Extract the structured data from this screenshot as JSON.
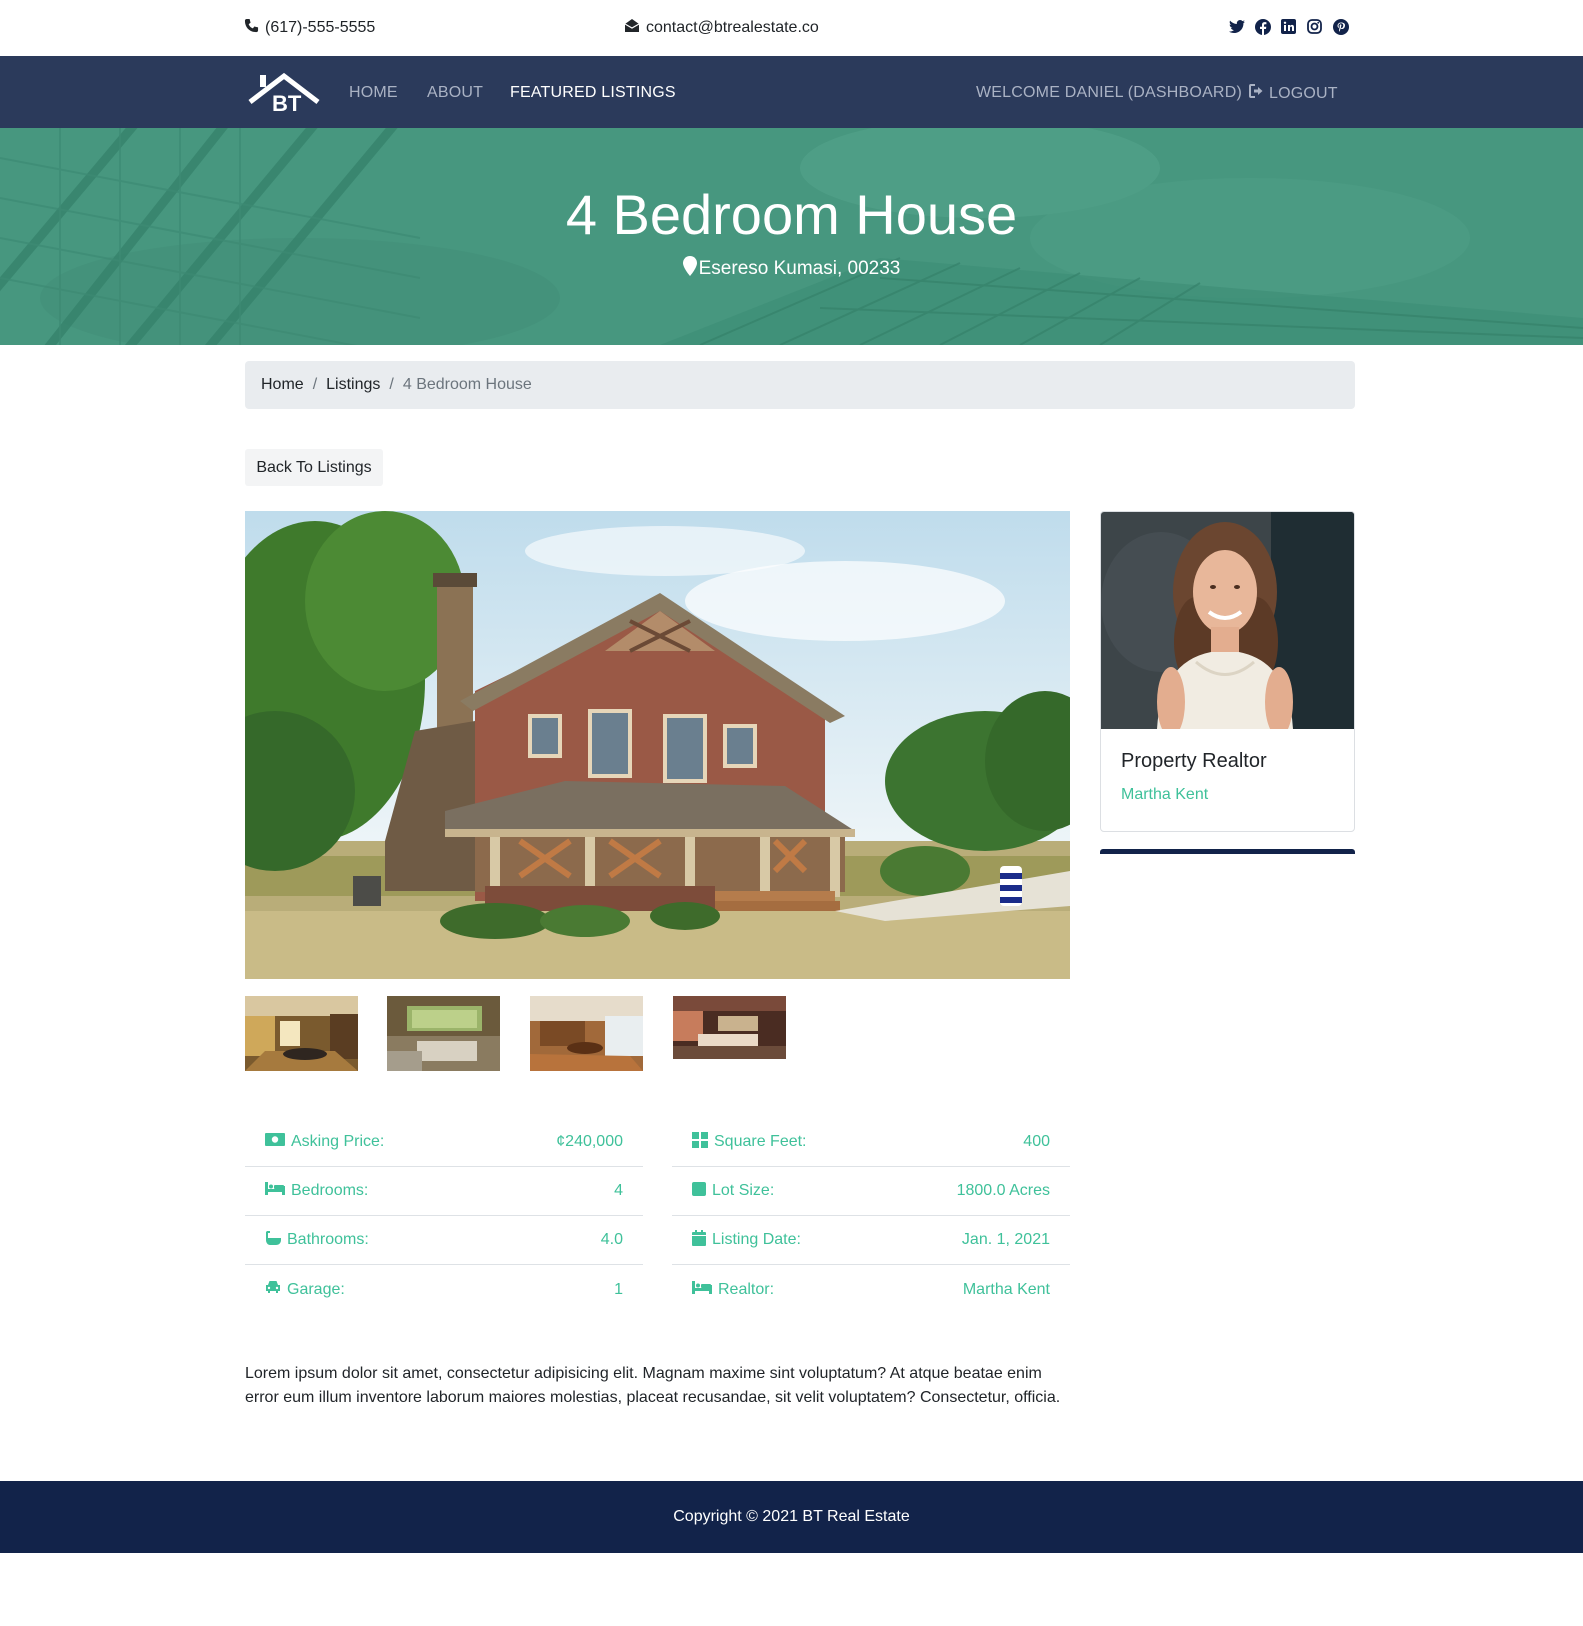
{
  "topbar": {
    "phone": "(617)-555-5555",
    "email": "contact@btrealestate.co",
    "socials": [
      "twitter-icon",
      "facebook-icon",
      "linkedin-icon",
      "instagram-icon",
      "pinterest-icon"
    ]
  },
  "nav": {
    "logo_text": "BT",
    "home": "HOME",
    "about": "ABOUT",
    "featured": "FEATURED LISTINGS",
    "welcome": "WELCOME DANIEL (DASHBOARD)",
    "logout": "LOGOUT"
  },
  "hero": {
    "title": "4 Bedroom House",
    "location": "Esereso Kumasi, 00233"
  },
  "breadcrumb": {
    "home": "Home",
    "listings": "Listings",
    "current": "4 Bedroom House"
  },
  "back_button": "Back To Listings",
  "details_left": [
    {
      "label": "Asking Price:",
      "value": "¢240,000",
      "icon": "money-icon"
    },
    {
      "label": "Bedrooms:",
      "value": "4",
      "icon": "bed-icon"
    },
    {
      "label": "Bathrooms:",
      "value": "4.0",
      "icon": "bath-icon"
    },
    {
      "label": "Garage:",
      "value": "1",
      "icon": "car-icon"
    }
  ],
  "details_right": [
    {
      "label": "Square Feet:",
      "value": "400",
      "icon": "grid-icon"
    },
    {
      "label": "Lot Size:",
      "value": "1800.0 Acres",
      "icon": "square-icon"
    },
    {
      "label": "Listing Date:",
      "value": "Jan. 1, 2021",
      "icon": "calendar-icon"
    },
    {
      "label": "Realtor:",
      "value": "Martha Kent",
      "icon": "bed-icon"
    }
  ],
  "description": "Lorem ipsum dolor sit amet, consectetur adipisicing elit. Magnam maxime sint voluptatum? At atque beatae enim error eum illum inventore laborum maiores molestias, placeat recusandae, sit velit voluptatem? Consectetur, officia.",
  "realtor": {
    "title": "Property Realtor",
    "name": "Martha Kent"
  },
  "footer": {
    "copyright": "Copyright © 2021 BT Real Estate"
  },
  "colors": {
    "navbar": "#2b3a5b",
    "hero": "#47977f",
    "accent": "#3fc19a",
    "footer": "#12234a"
  }
}
